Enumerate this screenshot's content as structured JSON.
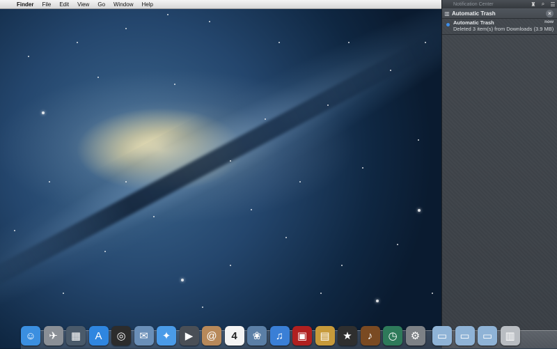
{
  "menubar": {
    "apple_icon": "apple-icon",
    "app_name": "Finder",
    "items": [
      "File",
      "Edit",
      "View",
      "Go",
      "Window",
      "Help"
    ]
  },
  "notification_center": {
    "title": "Notification Center",
    "app_header": "Automatic Trash",
    "notification": {
      "title": "Automatic Trash",
      "time": "now",
      "body": "Deleted 3 item(s) from Downloads (3.9 MB)"
    }
  },
  "dock": {
    "apps": [
      {
        "name": "finder-icon",
        "glyph": "☺",
        "color": "#3b8fe0"
      },
      {
        "name": "launchpad-icon",
        "glyph": "✈",
        "color": "#8a8f96"
      },
      {
        "name": "mission-control-icon",
        "glyph": "▦",
        "color": "#4a5a6a"
      },
      {
        "name": "app-store-icon",
        "glyph": "A",
        "color": "#2f86e0"
      },
      {
        "name": "dashboard-icon",
        "glyph": "◎",
        "color": "#2c2c2c"
      },
      {
        "name": "mail-icon",
        "glyph": "✉",
        "color": "#6a8fb8"
      },
      {
        "name": "safari-icon",
        "glyph": "✦",
        "color": "#4a9be8"
      },
      {
        "name": "facetime-icon",
        "glyph": "▶",
        "color": "#4a4f56"
      },
      {
        "name": "contacts-icon",
        "glyph": "@",
        "color": "#b8895a"
      },
      {
        "name": "calendar-icon",
        "glyph": "4",
        "color": "#f4f4f4"
      },
      {
        "name": "iphoto-icon",
        "glyph": "❀",
        "color": "#5b7fa6"
      },
      {
        "name": "itunes-icon",
        "glyph": "♫",
        "color": "#3a7fd6"
      },
      {
        "name": "photo-booth-icon",
        "glyph": "▣",
        "color": "#b02020"
      },
      {
        "name": "image-capture-icon",
        "glyph": "▤",
        "color": "#c79a3a"
      },
      {
        "name": "imovie-icon",
        "glyph": "★",
        "color": "#2f2f2f"
      },
      {
        "name": "garageband-icon",
        "glyph": "♪",
        "color": "#7a4a22"
      },
      {
        "name": "time-machine-icon",
        "glyph": "◷",
        "color": "#2e7a5a"
      },
      {
        "name": "system-preferences-icon",
        "glyph": "⚙",
        "color": "#7d8186"
      }
    ],
    "stacks": [
      {
        "name": "applications-folder-icon",
        "glyph": "▭",
        "color": "#8fb3d6"
      },
      {
        "name": "documents-folder-icon",
        "glyph": "▭",
        "color": "#8fb3d6"
      },
      {
        "name": "downloads-folder-icon",
        "glyph": "▭",
        "color": "#8fb3d6"
      },
      {
        "name": "trash-icon",
        "glyph": "▥",
        "color": "#b9bdc2"
      }
    ]
  }
}
